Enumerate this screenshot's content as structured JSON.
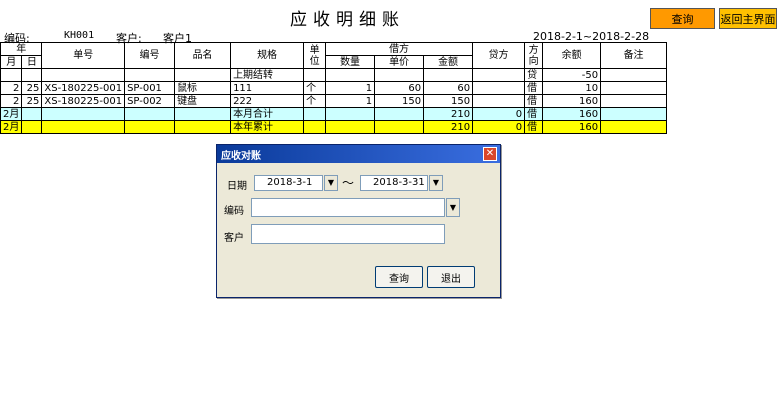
{
  "page": {
    "title": "应收明细账",
    "query_button": "查询",
    "home_button": "返回主界面",
    "code_label": "编码:",
    "code_value": "KH001",
    "customer_label": "客户:",
    "customer_value": "客户1",
    "date_range": "2018-2-1~2018-2-28"
  },
  "table": {
    "headers": {
      "year": "年",
      "month": "月",
      "day": "日",
      "voucher": "单号",
      "code": "编号",
      "product": "品名",
      "spec": "规格",
      "unit": "单位",
      "debit": "借方",
      "qty": "数量",
      "price": "单价",
      "amount": "金额",
      "credit": "贷方",
      "direction": "方向",
      "balance": "余额",
      "remark": "备注"
    },
    "rows": [
      {
        "month": "",
        "day": "",
        "voucher": "",
        "code": "",
        "product": "",
        "spec": "上期结转",
        "unit": "",
        "qty": "",
        "price": "",
        "amount": "",
        "credit": "",
        "dir": "贷",
        "balance": "-50",
        "remark": ""
      },
      {
        "month": "2",
        "day": "25",
        "voucher": "XS-180225-001",
        "code": "SP-001",
        "product": "鼠标",
        "spec": "111",
        "unit": "个",
        "qty": "1",
        "price": "60",
        "amount": "60",
        "credit": "",
        "dir": "借",
        "balance": "10",
        "remark": ""
      },
      {
        "month": "2",
        "day": "25",
        "voucher": "XS-180225-001",
        "code": "SP-002",
        "product": "键盘",
        "spec": "222",
        "unit": "个",
        "qty": "1",
        "price": "150",
        "amount": "150",
        "credit": "",
        "dir": "借",
        "balance": "160",
        "remark": ""
      },
      {
        "month": "2月",
        "day": "",
        "voucher": "",
        "code": "",
        "product": "",
        "spec": "本月合计",
        "unit": "",
        "qty": "",
        "price": "",
        "amount": "210",
        "credit": "0",
        "dir": "借",
        "balance": "160",
        "remark": ""
      },
      {
        "month": "2月",
        "day": "",
        "voucher": "",
        "code": "",
        "product": "",
        "spec": "本年累计",
        "unit": "",
        "qty": "",
        "price": "",
        "amount": "210",
        "credit": "0",
        "dir": "借",
        "balance": "160",
        "remark": ""
      }
    ]
  },
  "dialog": {
    "title": "应收对账",
    "date_label": "日期",
    "date_from": "2018-3-1",
    "date_sep": "～",
    "date_to": "2018-3-31",
    "code_label": "编码",
    "code_value": "",
    "customer_label": "客户",
    "customer_value": "",
    "query_button": "查询",
    "exit_button": "退出",
    "close_glyph": "✕",
    "dropdown_glyph": "▼"
  },
  "colors": {
    "query_button": "#ff9900",
    "home_button": "#ffc000",
    "month_row": "#ccffff",
    "year_row": "#ffff00",
    "dialog_title": "#0a3a9a"
  }
}
